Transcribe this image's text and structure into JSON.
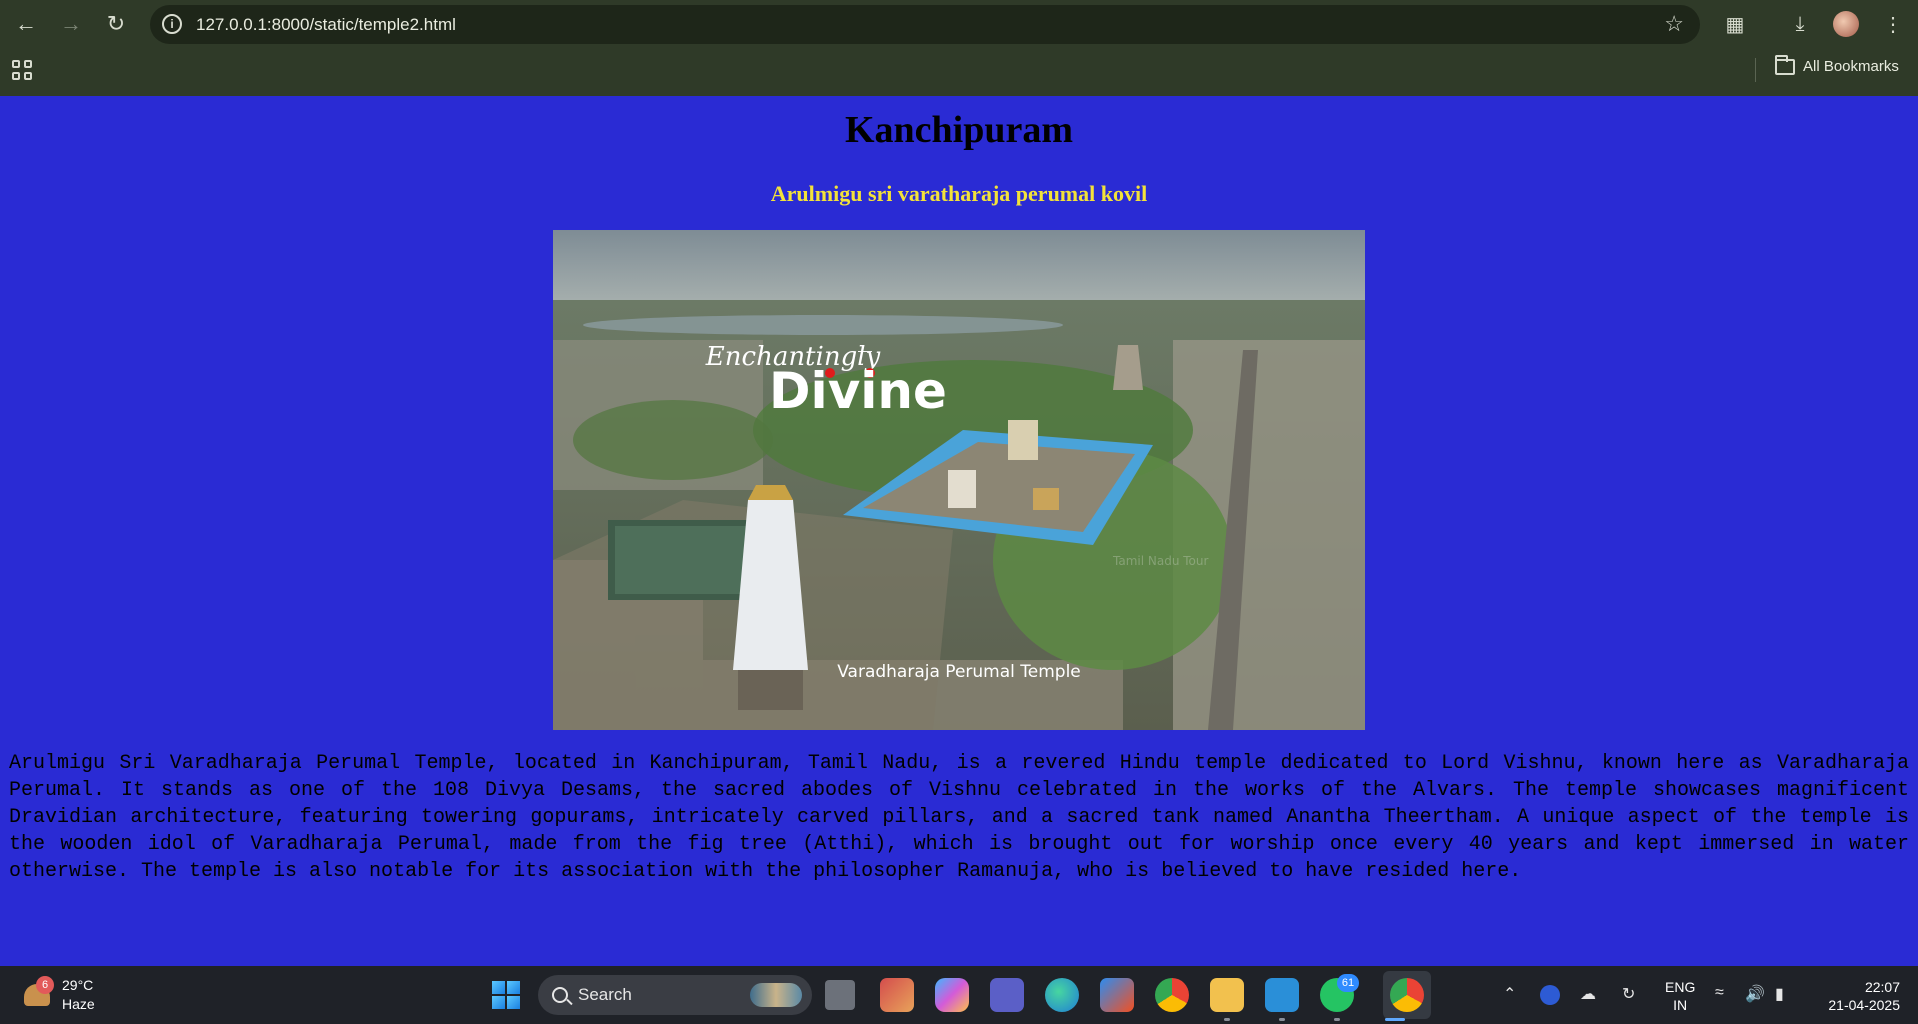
{
  "browser": {
    "url": "127.0.0.1:8000/static/temple2.html",
    "bookmarks_folder": "All Bookmarks",
    "icons": [
      "back-icon",
      "forward-icon",
      "reload-icon",
      "site-info-icon",
      "bookmark-star-icon",
      "extensions-icon",
      "download-icon",
      "profile-avatar",
      "menu-icon",
      "apps-grid-icon",
      "folder-icon"
    ]
  },
  "page": {
    "title": "Kanchipuram",
    "subtitle": "Arulmigu sri varatharaja perumal kovil",
    "image": {
      "overlay_script": "Enchantingly",
      "overlay_big": "Divine",
      "caption": "Varadharaja Perumal Temple",
      "watermark": "Tamil Nadu Tour"
    },
    "description": "Arulmigu Sri Varadharaja Perumal Temple, located in Kanchipuram, Tamil Nadu, is a revered Hindu temple dedicated to Lord Vishnu, known here as Varadharaja Perumal. It stands as one of the 108 Divya Desams, the sacred abodes of Vishnu celebrated in the works of the Alvars. The temple showcases magnificent Dravidian architecture, featuring towering gopurams, intricately carved pillars, and a sacred tank named Anantha Theertham. A unique aspect of the temple is the wooden idol of Varadharaja Perumal, made from the fig tree (Atthi), which is brought out for worship once every 40 years and kept immersed in water otherwise. The temple is also notable for its association with the philosopher Ramanuja, who is believed to have resided here."
  },
  "taskbar": {
    "weather": {
      "badge": "6",
      "temp": "29°C",
      "condition": "Haze"
    },
    "search_placeholder": "Search",
    "whatsapp_badge": "61",
    "lang_top": "ENG",
    "lang_bottom": "IN",
    "time": "22:07",
    "date": "21-04-2025"
  },
  "colors": {
    "page_background": "#2a2bd4",
    "subtitle": "#f3e23a",
    "chrome": "#2f3a28",
    "taskbar": "#1f2228"
  }
}
